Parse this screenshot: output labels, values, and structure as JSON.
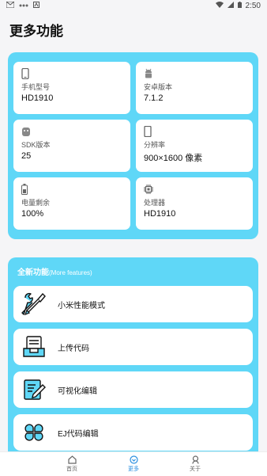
{
  "status": {
    "time": "2:50"
  },
  "page": {
    "title": "更多功能"
  },
  "device_info": [
    {
      "icon": "phone-icon",
      "label": "手机型号",
      "value": "HD1910"
    },
    {
      "icon": "android-icon",
      "label": "安卓版本",
      "value": "7.1.2"
    },
    {
      "icon": "sdk-icon",
      "label": "SDK版本",
      "value": "25"
    },
    {
      "icon": "screen-icon",
      "label": "分辨率",
      "value": "900×1600 像素"
    },
    {
      "icon": "battery-icon",
      "label": "电量剩余",
      "value": "100%"
    },
    {
      "icon": "cpu-icon",
      "label": "处理器",
      "value": "HD1910"
    }
  ],
  "features": {
    "title": "全新功能",
    "subtitle": "(More features)",
    "items": [
      {
        "icon": "tools-icon",
        "label": "小米性能模式"
      },
      {
        "icon": "upload-icon",
        "label": "上传代码"
      },
      {
        "icon": "edit-icon",
        "label": "可视化编辑"
      },
      {
        "icon": "clover-icon",
        "label": "EJ代码编辑"
      }
    ]
  },
  "nav": [
    {
      "icon": "home-icon",
      "label": "首页"
    },
    {
      "icon": "more-icon",
      "label": "更多",
      "active": true
    },
    {
      "icon": "about-icon",
      "label": "关于"
    }
  ],
  "colors": {
    "accent": "#5fd7f7",
    "nav_active": "#2a8fe0"
  }
}
